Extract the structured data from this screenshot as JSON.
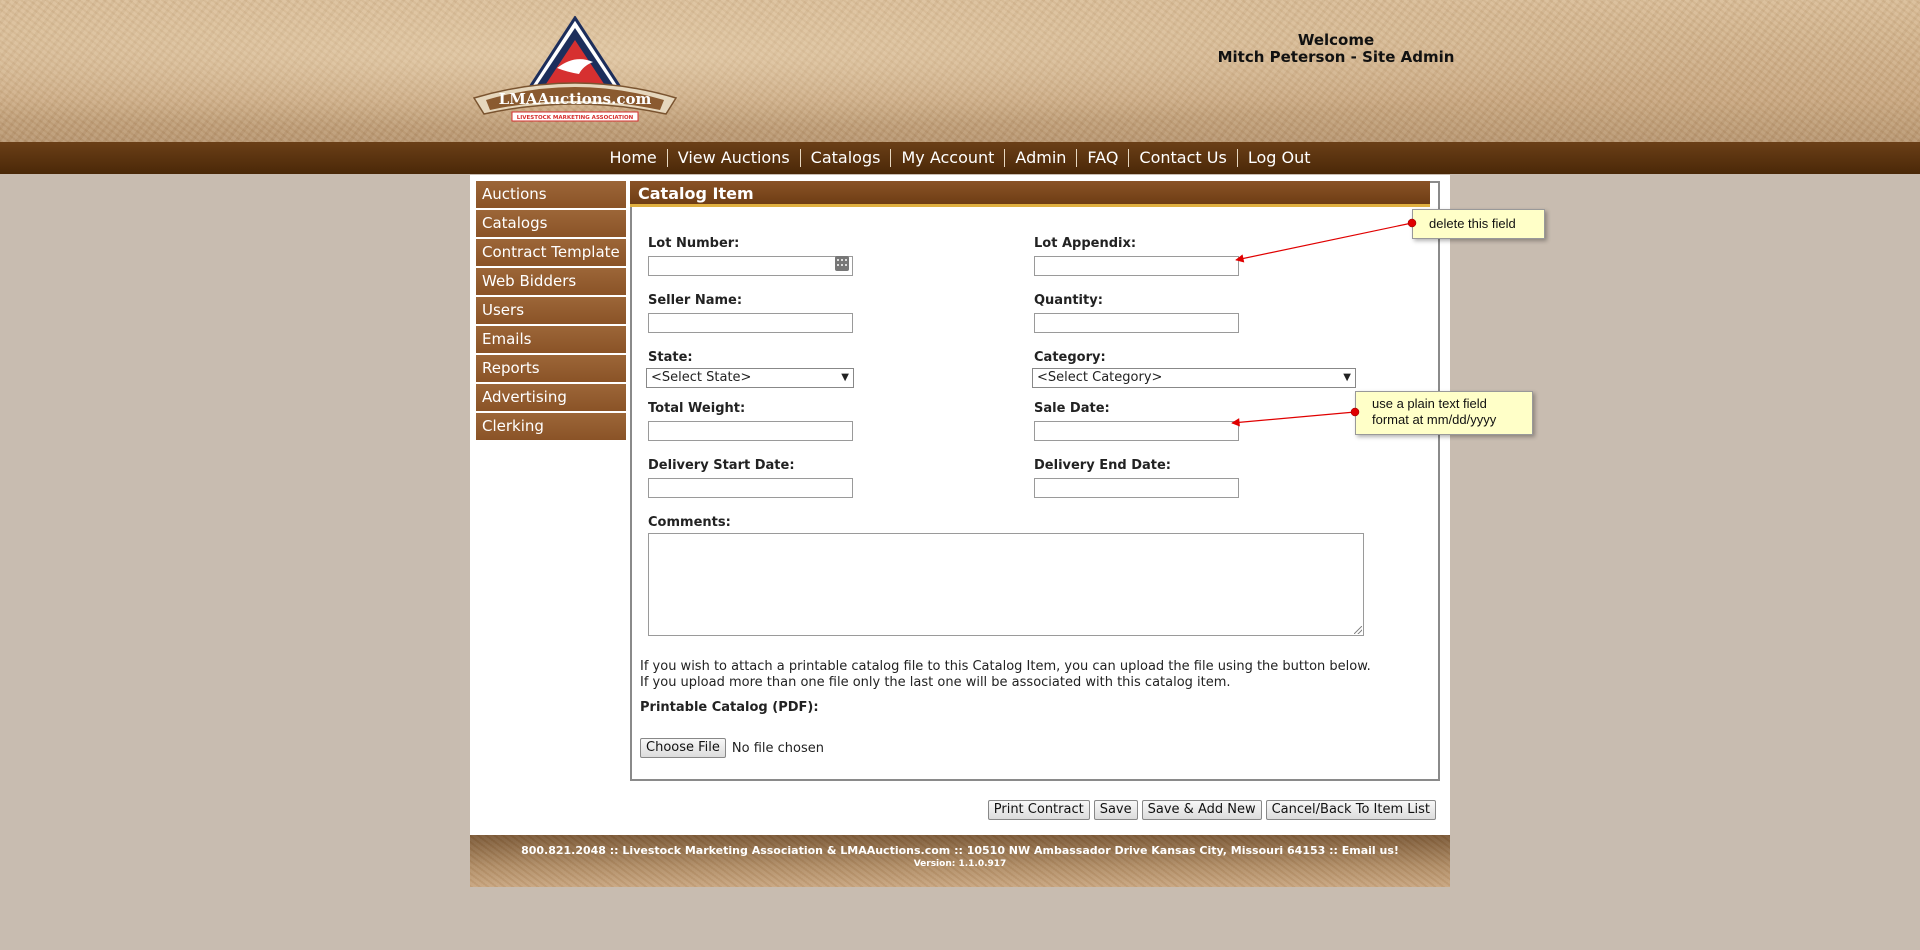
{
  "header": {
    "logo_text": "LMAAuctions.com",
    "logo_subtext": "LIVESTOCK MARKETING ASSOCIATION",
    "welcome": "Welcome",
    "user": "Mitch Peterson - Site Admin"
  },
  "nav": [
    "Home",
    "View Auctions",
    "Catalogs",
    "My Account",
    "Admin",
    "FAQ",
    "Contact Us",
    "Log Out"
  ],
  "sidebar": [
    "Auctions",
    "Catalogs",
    "Contract Template",
    "Web Bidders",
    "Users",
    "Emails",
    "Reports",
    "Advertising",
    "Clerking"
  ],
  "form": {
    "title": "Catalog Item",
    "lot_number": "Lot Number:",
    "lot_appendix": "Lot Appendix:",
    "seller_name": "Seller Name:",
    "quantity": "Quantity:",
    "state": "State:",
    "state_value": "<Select State>",
    "category": "Category:",
    "category_value": "<Select Category>",
    "total_weight": "Total Weight:",
    "sale_date": "Sale Date:",
    "delivery_start": "Delivery Start Date:",
    "delivery_end": "Delivery End Date:",
    "comments": "Comments:",
    "upload_text": "If you wish to attach a printable catalog file to this Catalog Item, you can upload the file using the button below. If you upload more than one file only the last one will be associated with this catalog item.",
    "pdf_label": "Printable Catalog (PDF):",
    "choose_file": "Choose File",
    "no_file": "No file chosen"
  },
  "buttons": [
    "Print Contract",
    "Save",
    "Save & Add New",
    "Cancel/Back To Item List"
  ],
  "footer": {
    "line1": "800.821.2048 :: Livestock Marketing Association & LMAAuctions.com :: 10510 NW Ambassador Drive Kansas City, Missouri 64153 :: Email us!",
    "line2": "Version: 1.1.0.917"
  },
  "annotations": {
    "delete_field": "delete this field",
    "plain_text_1": "use a plain text field",
    "plain_text_2": "format at mm/dd/yyyy"
  },
  "colors": {
    "nav_bg": "#5a3210",
    "sidebar_item": "#935c2f",
    "annotation_arrow": "#e00000",
    "callout_bg": "#ffffc8"
  }
}
